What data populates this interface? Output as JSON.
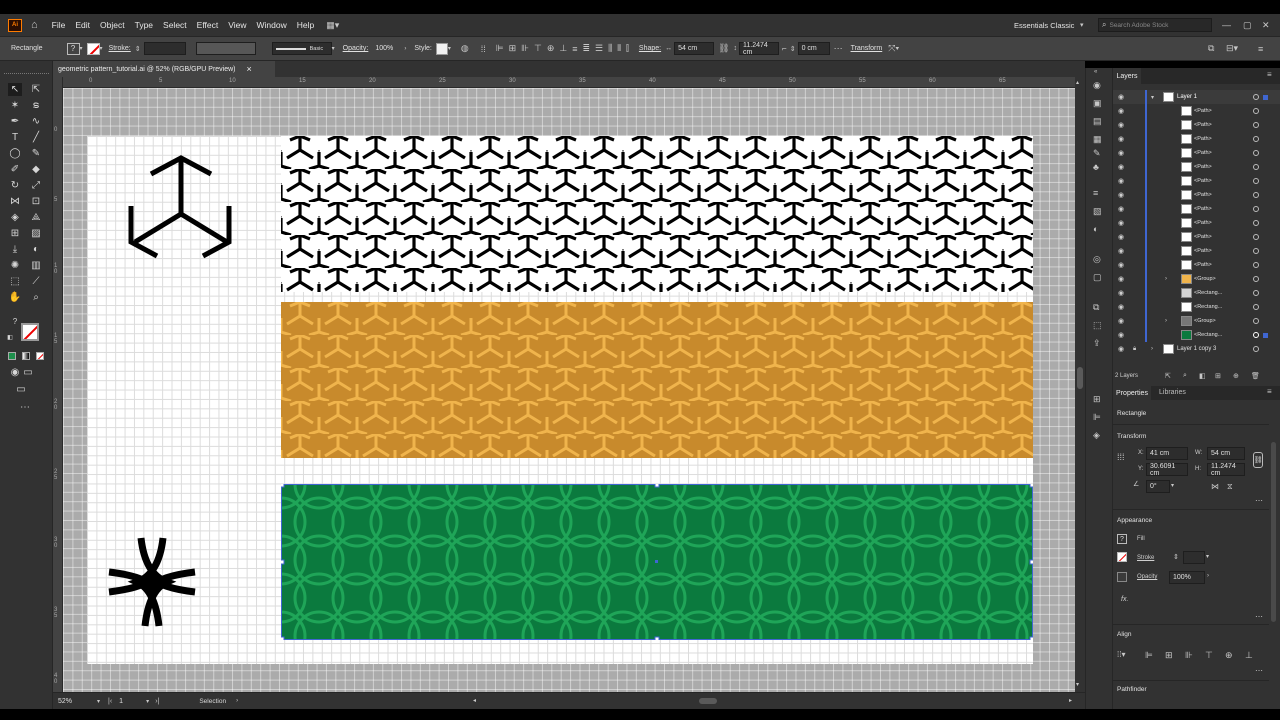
{
  "menubar": {
    "app_icon": "Ai",
    "items": [
      "File",
      "Edit",
      "Object",
      "Type",
      "Select",
      "Effect",
      "View",
      "Window",
      "Help"
    ],
    "workspace": "Essentials Classic",
    "search_placeholder": "Search Adobe Stock"
  },
  "controlbar": {
    "selection_type": "Rectangle",
    "stroke_label": "Stroke:",
    "stroke_style": "Basic",
    "opacity_label": "Opacity:",
    "opacity_value": "100%",
    "style_label": "Style:",
    "shape_label": "Shape:",
    "shape_w": "54 cm",
    "shape_h": "11.2474 cm",
    "corner": "0 cm",
    "transform_label": "Transform"
  },
  "document": {
    "tab_title": "geometric pattern_tutorial.ai @ 52% (RGB/GPU Preview)",
    "close": "×"
  },
  "rulers": {
    "h_ticks": [
      "0",
      "5",
      "10",
      "15",
      "20",
      "25",
      "30",
      "35",
      "40",
      "45",
      "50",
      "55",
      "60",
      "65"
    ],
    "v_ticks": [
      "0",
      "5",
      "1 0",
      "1 5",
      "2 0",
      "2 5",
      "3 0",
      "3 5",
      "4 0"
    ]
  },
  "statusbar": {
    "zoom": "52%",
    "artboard": "1",
    "tool": "Selection"
  },
  "colors": {
    "pattern_black": "#000000",
    "pattern_orange": "#c88a2c",
    "pattern_orange_light": "#f0b44c",
    "pattern_green": "#0b7a3e",
    "pattern_green_light": "#1fa558",
    "selection_blue": "#3f66d1"
  },
  "layers_panel": {
    "tab": "Layers",
    "rows": [
      {
        "name": "Layer 1",
        "thumb": "layer"
      },
      {
        "name": "<Path>",
        "thumb": "path"
      },
      {
        "name": "<Path>",
        "thumb": "path"
      },
      {
        "name": "<Path>",
        "thumb": "path"
      },
      {
        "name": "<Path>",
        "thumb": "path"
      },
      {
        "name": "<Path>",
        "thumb": "path"
      },
      {
        "name": "<Path>",
        "thumb": "path"
      },
      {
        "name": "<Path>",
        "thumb": "path"
      },
      {
        "name": "<Path>",
        "thumb": "path"
      },
      {
        "name": "<Path>",
        "thumb": "path"
      },
      {
        "name": "<Path>",
        "thumb": "path"
      },
      {
        "name": "<Path>",
        "thumb": "path"
      },
      {
        "name": "<Path>",
        "thumb": "path"
      },
      {
        "name": "<Group>",
        "thumb": "group"
      },
      {
        "name": "<Rectang...",
        "thumb": "rect"
      },
      {
        "name": "<Rectang...",
        "thumb": "rect"
      },
      {
        "name": "<Group>",
        "thumb": "group"
      },
      {
        "name": "<Rectang...",
        "thumb": "rect"
      },
      {
        "name": "Layer 1 copy 3",
        "thumb": "layer"
      }
    ],
    "count": "2 Layers"
  },
  "properties_panel": {
    "tabs": [
      "Properties",
      "Libraries"
    ],
    "object_type": "Rectangle",
    "transform": {
      "title": "Transform",
      "x_label": "X:",
      "x": "41 cm",
      "y_label": "Y:",
      "y": "30.6091 cm",
      "w_label": "W:",
      "w": "54 cm",
      "h_label": "H:",
      "h": "11.2474 cm",
      "angle": "0°"
    },
    "appearance": {
      "title": "Appearance",
      "fill_label": "Fill",
      "stroke_label": "Stroke",
      "opacity_label": "Opacity",
      "opacity_value": "100%",
      "fx": "fx."
    },
    "align_title": "Align",
    "pathfinder_title": "Pathfinder"
  }
}
